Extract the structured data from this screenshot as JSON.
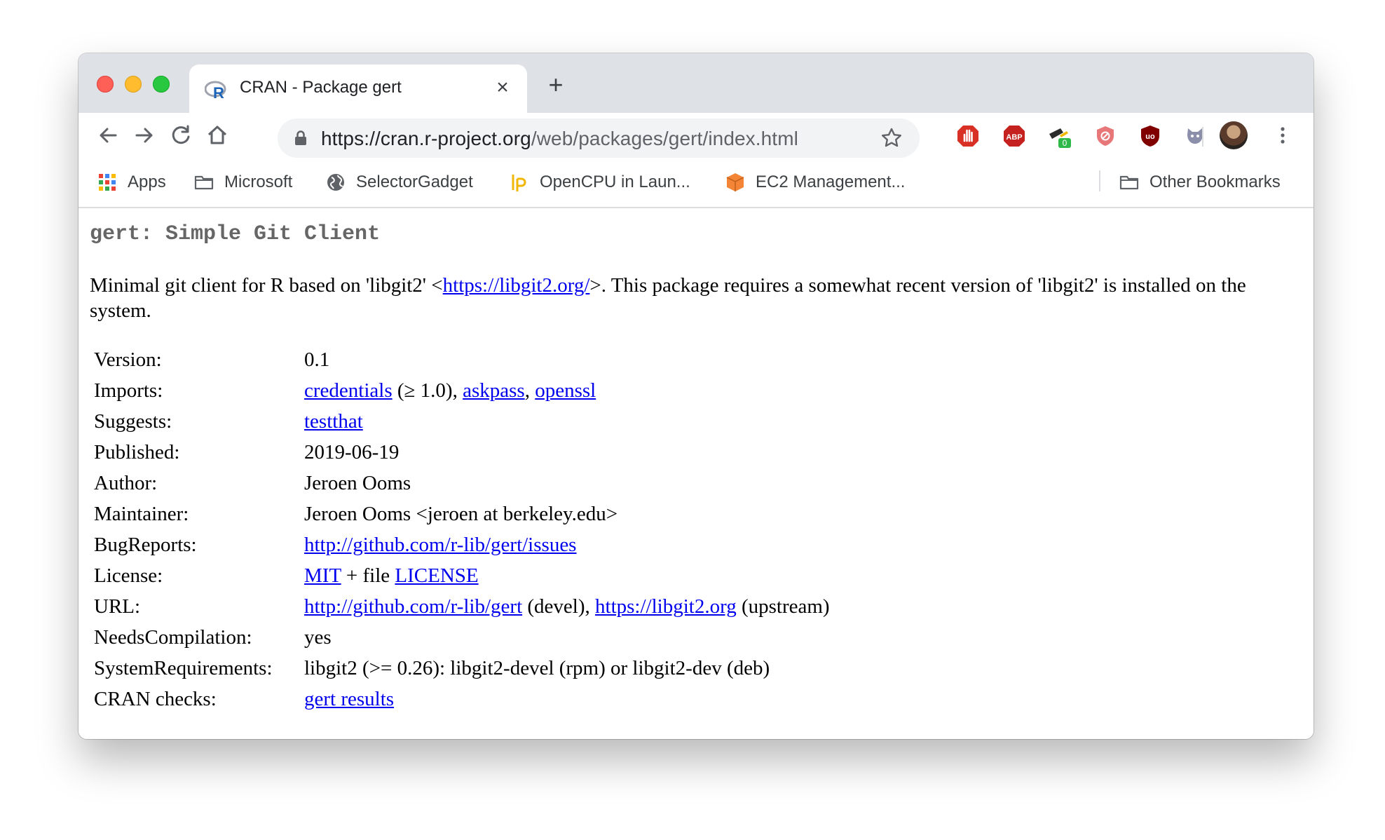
{
  "browser": {
    "tab_title": "CRAN - Package gert",
    "tab_close": "×",
    "new_tab": "+",
    "url_host": "https://cran.r-project.org",
    "url_path": "/web/packages/gert/index.html",
    "extensions": [
      {
        "name": "hand-stop-icon",
        "color": "#d93025"
      },
      {
        "name": "adblock-plus-icon",
        "label": "ABP",
        "color": "#c5221f"
      },
      {
        "name": "selectorgadget-icon",
        "badge": "0",
        "badge_color": "#2fb84a"
      },
      {
        "name": "privacy-badger-icon",
        "color": "#e8777a"
      },
      {
        "name": "ublock-icon",
        "label": "uo",
        "color": "#800000"
      },
      {
        "name": "octocat-icon",
        "color": "#8c8faa"
      }
    ]
  },
  "bookmarks": {
    "apps": "Apps",
    "microsoft": "Microsoft",
    "selectorgadget": "SelectorGadget",
    "opencpu": "OpenCPU in Laun...",
    "ec2": "EC2 Management...",
    "other": "Other Bookmarks"
  },
  "page": {
    "title": "gert: Simple Git Client",
    "desc_before": "Minimal git client for R based on 'libgit2' <",
    "desc_link": "https://libgit2.org/",
    "desc_after": ">. This package requires a somewhat recent version of 'libgit2' is installed on the system.",
    "version_label": "Version:",
    "version": "0.1",
    "imports_label": "Imports:",
    "imports_1": "credentials",
    "imports_1_suffix": " (≥ 1.0), ",
    "imports_2": "askpass",
    "imports_sep": ", ",
    "imports_3": "openssl",
    "suggests_label": "Suggests:",
    "suggests": "testthat",
    "published_label": "Published:",
    "published": "2019-06-19",
    "author_label": "Author:",
    "author": "Jeroen Ooms",
    "maintainer_label": "Maintainer:",
    "maintainer": "Jeroen Ooms <jeroen at berkeley.edu>",
    "bugreports_label": "BugReports:",
    "bugreports": "http://github.com/r-lib/gert/issues",
    "license_label": "License:",
    "license_1": "MIT",
    "license_mid": " + file ",
    "license_2": "LICENSE",
    "url_label": "URL:",
    "url_1": "http://github.com/r-lib/gert",
    "url_1_suffix": " (devel), ",
    "url_2": "https://libgit2.org",
    "url_2_suffix": " (upstream)",
    "needscomp_label": "NeedsCompilation:",
    "needscomp": "yes",
    "sysreq_label": "SystemRequirements:",
    "sysreq": "libgit2 (>= 0.26): libgit2-devel (rpm) or libgit2-dev (deb)",
    "checks_label": "CRAN checks:",
    "checks": "gert results"
  }
}
